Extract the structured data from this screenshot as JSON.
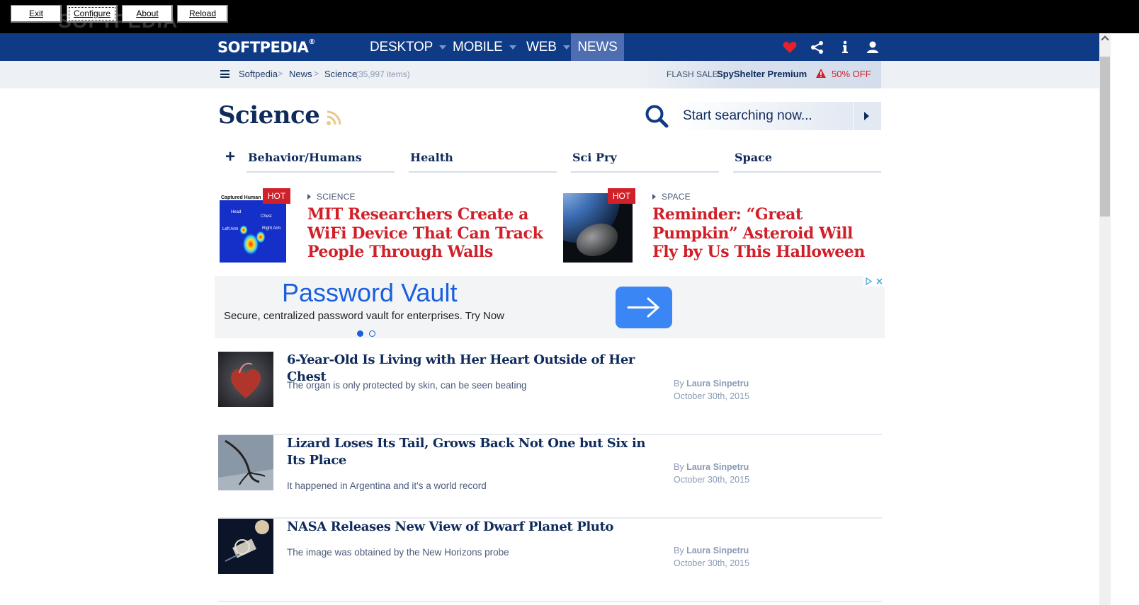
{
  "toolbar": {
    "exit": "Exit",
    "configure": "Configure",
    "about": "About",
    "reload": "Reload",
    "watermark": "SOFTPEDIA"
  },
  "nav": {
    "logo": "SOFTPEDIA",
    "logo_mark": "®",
    "items": [
      {
        "label": "DESKTOP"
      },
      {
        "label": "MOBILE"
      },
      {
        "label": "WEB"
      },
      {
        "label": "NEWS"
      }
    ],
    "icons": [
      "heart-icon",
      "share-icon",
      "info-icon",
      "user-icon"
    ]
  },
  "breadcrumb": {
    "items": [
      "Softpedia",
      "News",
      "Science"
    ],
    "separator": ">",
    "count": "(35,997 items)"
  },
  "flash_sale": {
    "label": "FLASH SALE:",
    "product": "SpyShelter Premium",
    "discount": "50% OFF"
  },
  "page": {
    "title": "Science"
  },
  "search": {
    "placeholder": "Start searching now..."
  },
  "subcategories": [
    "Behavior/Humans",
    "Health",
    "Sci Pry",
    "Space"
  ],
  "featured": [
    {
      "badge": "HOT",
      "category": "SCIENCE",
      "title": "MIT Researchers Create a WiFi Device That Can Track People Through Walls",
      "thumb_caption": "Captured Human",
      "thumb_labels": [
        "Head",
        "Chest",
        "Left Arm",
        "Right Arm"
      ]
    },
    {
      "badge": "HOT",
      "category": "SPACE",
      "title": "Reminder: “Great Pumpkin” Asteroid Will Fly by Us This Halloween"
    }
  ],
  "ad": {
    "title": "Password Vault",
    "description": "Secure, centralized password vault for enterprises. Try Now"
  },
  "articles": [
    {
      "title": "6-Year-Old Is Living with Her Heart Outside of Her Chest",
      "description": "The organ is only protected by skin, can be seen beating",
      "by": "By",
      "author": "Laura Sinpetru",
      "date": "October 30th, 2015"
    },
    {
      "title": "Lizard Loses Its Tail, Grows Back Not One but Six in Its Place",
      "description": "It happened in Argentina and it's a world record",
      "by": "By",
      "author": "Laura Sinpetru",
      "date": "October 30th, 2015"
    },
    {
      "title": "NASA Releases New View of Dwarf Planet Pluto",
      "description": "The image was obtained by the New Horizons probe",
      "by": "By",
      "author": "Laura Sinpetru",
      "date": "October 30th, 2015"
    }
  ],
  "colors": {
    "brand_navy": "#0f3a85",
    "accent_red": "#d0202a",
    "title_navy": "#0f2b5b",
    "ad_blue": "#1a5fe0"
  }
}
